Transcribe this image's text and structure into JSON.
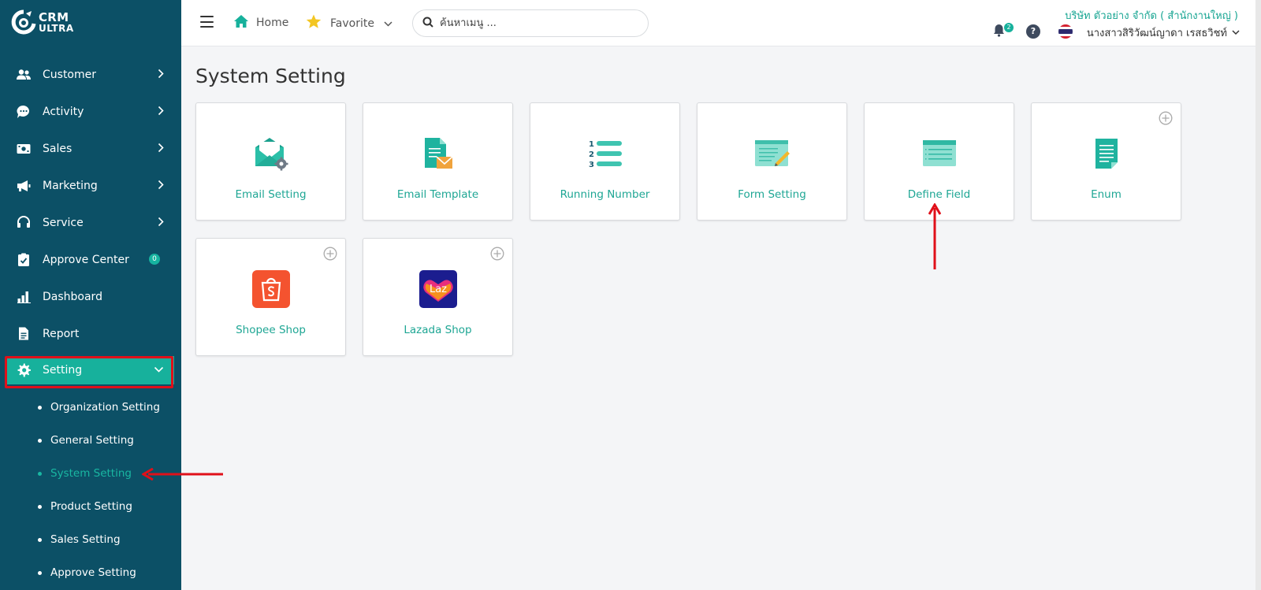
{
  "app": {
    "logo_line1": "CRM",
    "logo_line2": "ULTRA",
    "brand_color": "#0c5066",
    "accent_color": "#17b19c"
  },
  "sidebar": {
    "items": [
      {
        "label": "Customer",
        "icon": "users-icon"
      },
      {
        "label": "Activity",
        "icon": "chat-icon"
      },
      {
        "label": "Sales",
        "icon": "cash-icon"
      },
      {
        "label": "Marketing",
        "icon": "megaphone-icon"
      },
      {
        "label": "Service",
        "icon": "headset-icon"
      },
      {
        "label": "Approve Center",
        "icon": "clipboard-check-icon",
        "badge": "0"
      },
      {
        "label": "Dashboard",
        "icon": "bar-chart-icon"
      },
      {
        "label": "Report",
        "icon": "file-icon"
      },
      {
        "label": "Setting",
        "icon": "gear-icon",
        "active": true
      }
    ],
    "sub_items": [
      {
        "label": "Organization Setting"
      },
      {
        "label": "General Setting"
      },
      {
        "label": "System Setting",
        "current": true
      },
      {
        "label": "Product Setting"
      },
      {
        "label": "Sales Setting"
      },
      {
        "label": "Approve Setting"
      }
    ]
  },
  "header": {
    "home_label": "Home",
    "favorite_label": "Favorite",
    "search_placeholder": "ค้นหาเมนู ...",
    "notification_count": "2",
    "help_label": "?",
    "company": "บริษัท ตัวอย่าง จำกัด ( สำนักงานใหญ่ )",
    "user_name": "นางสาวสิริวัฒน์ญาดา เรสธวิชท์"
  },
  "main": {
    "title": "System Setting",
    "cards": [
      {
        "label": "Email Setting",
        "icon": "email-settings-icon"
      },
      {
        "label": "Email Template",
        "icon": "email-template-icon"
      },
      {
        "label": "Running Number",
        "icon": "numbered-list-icon"
      },
      {
        "label": "Form Setting",
        "icon": "form-edit-icon"
      },
      {
        "label": "Define Field",
        "icon": "field-list-icon"
      },
      {
        "label": "Enum",
        "icon": "document-icon",
        "has_plus": true
      },
      {
        "label": "Shopee Shop",
        "icon": "shopee-logo-icon",
        "has_plus": true
      },
      {
        "label": "Lazada Shop",
        "icon": "lazada-logo-icon",
        "logo_text": "Laz",
        "has_plus": true
      }
    ]
  }
}
